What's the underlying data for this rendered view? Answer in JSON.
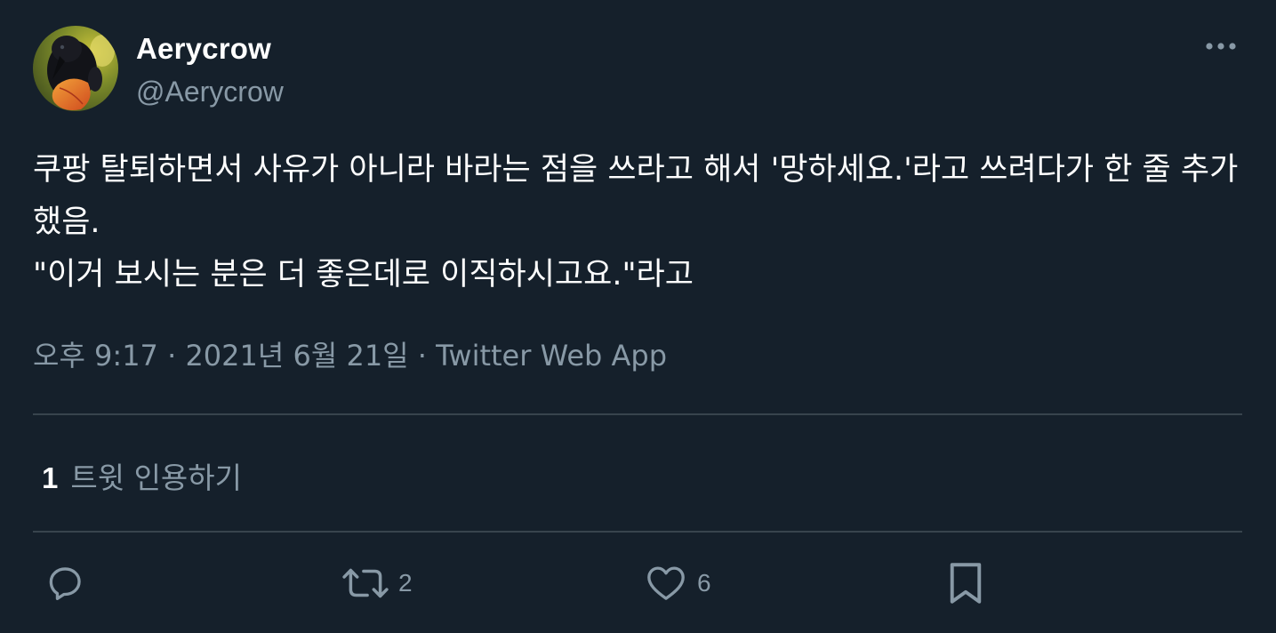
{
  "author": {
    "display_name": "Aerycrow",
    "handle": "@Aerycrow"
  },
  "tweet": {
    "text": "쿠팡 탈퇴하면서 사유가 아니라 바라는 점을 쓰라고 해서 '망하세요.'라고 쓰려다가 한 줄 추가했음.\n\"이거 보시는 분은 더 좋은데로 이직하시고요.\"라고"
  },
  "meta": {
    "time": "오후 9:17",
    "separator": "·",
    "date": "2021년 6월 21일",
    "source": "Twitter Web App"
  },
  "quotes": {
    "count": "1",
    "label": "트윗 인용하기"
  },
  "actions": {
    "reply_icon": "reply-icon",
    "retweet_icon": "retweet-icon",
    "retweet_count": "2",
    "like_icon": "heart-icon",
    "like_count": "6",
    "bookmark_icon": "bookmark-icon"
  },
  "colors": {
    "background": "#15202b",
    "text_primary": "#ffffff",
    "text_secondary": "#8899a6",
    "divider": "#38444d"
  }
}
